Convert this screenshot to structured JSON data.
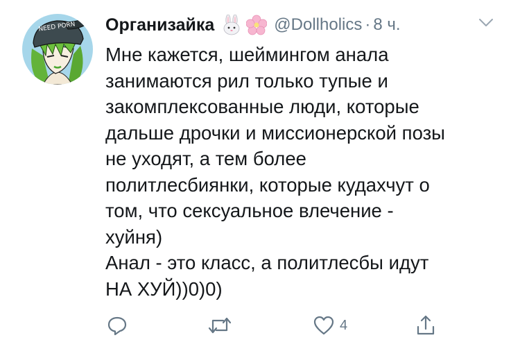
{
  "tweet": {
    "author_name": "Организайка",
    "author_emojis": [
      "rabbit-face-icon",
      "cherry-blossom-icon"
    ],
    "handle": "@Dollholics",
    "separator": "·",
    "time": "8 ч.",
    "text_lines": [
      "Мне кажется, шеймингом анала",
      "занимаются рил только тупые и",
      "закомплексованные люди, которые",
      "дальше дрочки и миссионерской позы",
      "не уходят, а тем более",
      "политлесбиянки, которые кудахчут о",
      "том, что сексуальное влечение -",
      "хуйня)",
      "Анал - это класс, а политлесбы идут",
      "НА ХУЙ))0)0)"
    ],
    "avatar_cap_text": "NEED PORN",
    "actions": {
      "reply_count": "",
      "retweet_count": "",
      "like_count": "4"
    }
  },
  "colors": {
    "text": "#14171a",
    "secondary": "#657786",
    "avatar_bg": "#a6d6ea",
    "cap": "#3d4a4f",
    "hair": "#63b33a"
  }
}
